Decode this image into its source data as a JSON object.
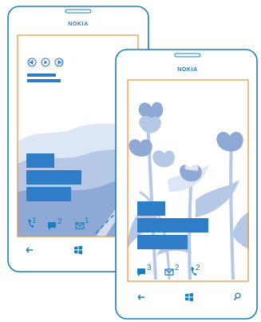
{
  "phones": [
    {
      "brand": "NOKIA",
      "notifications": [
        {
          "icon": "phone-icon",
          "count": "1"
        },
        {
          "icon": "message-icon",
          "count": "2"
        },
        {
          "icon": "mail-icon",
          "count": "1"
        }
      ],
      "nav_buttons": [
        "back-button",
        "windows-start-button"
      ]
    },
    {
      "brand": "NOKIA",
      "notifications": [
        {
          "icon": "message-icon",
          "count": "3"
        },
        {
          "icon": "mail-icon",
          "count": "2"
        },
        {
          "icon": "phone-icon",
          "count": "2"
        }
      ],
      "nav_buttons": [
        "back-button",
        "windows-start-button",
        "search-button"
      ]
    }
  ],
  "colors": {
    "outline": "#1a7fc1",
    "tile": "#2f7dc7",
    "screen_border": "#e8913d",
    "wallpaper_light": "#dde6f4",
    "wallpaper_mid": "#b5c8e6",
    "wallpaper_dark": "#8ea9d6"
  }
}
